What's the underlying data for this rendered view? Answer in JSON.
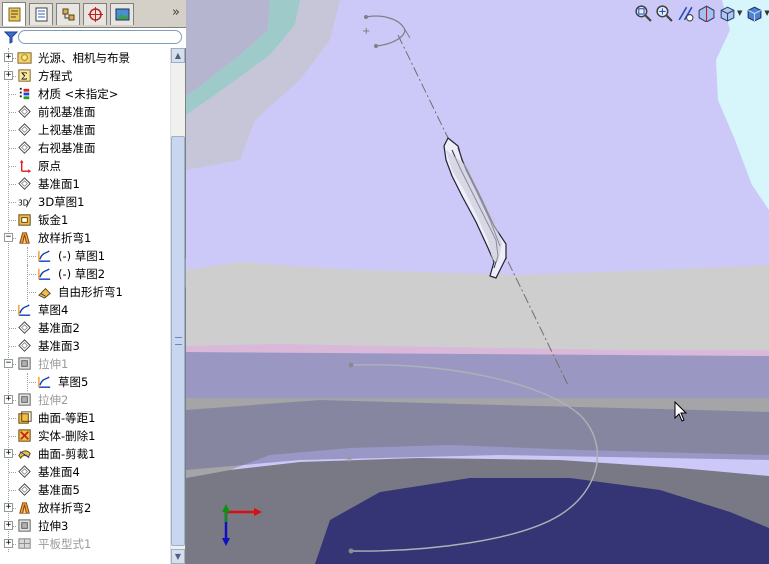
{
  "left_panel": {
    "tabs": [
      {
        "name": "feature-manager-tab",
        "icon": "feature-tree-icon",
        "active": true
      },
      {
        "name": "property-manager-tab",
        "icon": "property-manager-icon",
        "active": false
      },
      {
        "name": "configuration-manager-tab",
        "icon": "configuration-manager-icon",
        "active": false
      },
      {
        "name": "dimxpert-manager-tab",
        "icon": "dimxpert-icon",
        "active": false
      },
      {
        "name": "display-manager-tab",
        "icon": "display-manager-icon",
        "active": false
      }
    ],
    "collapse_glyph": "»",
    "filter": {
      "icon": "filter-icon",
      "value": ""
    }
  },
  "tree": {
    "items": [
      {
        "label": "光源、相机与布景",
        "icon": "lights-cameras-icon",
        "expandable": true,
        "indent": 0,
        "suppressed": false
      },
      {
        "label": "方程式",
        "icon": "equations-icon",
        "expandable": true,
        "indent": 0,
        "suppressed": false
      },
      {
        "label": "材质 <未指定>",
        "icon": "material-icon",
        "expandable": false,
        "indent": 0,
        "suppressed": false
      },
      {
        "label": "前视基准面",
        "icon": "plane-icon",
        "expandable": false,
        "indent": 0,
        "suppressed": false
      },
      {
        "label": "上视基准面",
        "icon": "plane-icon",
        "expandable": false,
        "indent": 0,
        "suppressed": false
      },
      {
        "label": "右视基准面",
        "icon": "plane-icon",
        "expandable": false,
        "indent": 0,
        "suppressed": false
      },
      {
        "label": "原点",
        "icon": "origin-icon",
        "expandable": false,
        "indent": 0,
        "suppressed": false
      },
      {
        "label": "基准面1",
        "icon": "plane-icon",
        "expandable": false,
        "indent": 0,
        "suppressed": false
      },
      {
        "label": "3D草图1",
        "icon": "3d-sketch-icon",
        "expandable": false,
        "indent": 0,
        "suppressed": false
      },
      {
        "label": "钣金1",
        "icon": "sheet-metal-icon",
        "expandable": false,
        "indent": 0,
        "suppressed": false
      },
      {
        "label": "放样折弯1",
        "icon": "lofted-bend-icon",
        "expandable": true,
        "expanded": true,
        "indent": 0,
        "suppressed": false
      },
      {
        "label": "(-) 草图1",
        "icon": "sketch-icon",
        "expandable": false,
        "indent": 1,
        "suppressed": false
      },
      {
        "label": "(-) 草图2",
        "icon": "sketch-icon",
        "expandable": false,
        "indent": 1,
        "suppressed": false
      },
      {
        "label": "自由形折弯1",
        "icon": "freeform-bend-icon",
        "expandable": false,
        "indent": 1,
        "suppressed": false
      },
      {
        "label": "草图4",
        "icon": "sketch-icon",
        "expandable": false,
        "indent": 0,
        "suppressed": false
      },
      {
        "label": "基准面2",
        "icon": "plane-icon",
        "expandable": false,
        "indent": 0,
        "suppressed": false
      },
      {
        "label": "基准面3",
        "icon": "plane-icon",
        "expandable": false,
        "indent": 0,
        "suppressed": false
      },
      {
        "label": "拉伸1",
        "icon": "extrude-icon",
        "expandable": true,
        "expanded": true,
        "indent": 0,
        "suppressed": true
      },
      {
        "label": "草图5",
        "icon": "sketch-icon",
        "expandable": false,
        "indent": 1,
        "suppressed": false
      },
      {
        "label": "拉伸2",
        "icon": "extrude-icon",
        "expandable": true,
        "indent": 0,
        "suppressed": true
      },
      {
        "label": "曲面-等距1",
        "icon": "offset-surface-icon",
        "expandable": false,
        "indent": 0,
        "suppressed": false
      },
      {
        "label": "实体-删除1",
        "icon": "delete-body-icon",
        "expandable": false,
        "indent": 0,
        "suppressed": false
      },
      {
        "label": "曲面-剪裁1",
        "icon": "trim-surface-icon",
        "expandable": true,
        "indent": 0,
        "suppressed": false
      },
      {
        "label": "基准面4",
        "icon": "plane-icon",
        "expandable": false,
        "indent": 0,
        "suppressed": false
      },
      {
        "label": "基准面5",
        "icon": "plane-icon",
        "expandable": false,
        "indent": 0,
        "suppressed": false
      },
      {
        "label": "放样折弯2",
        "icon": "lofted-bend-icon",
        "expandable": true,
        "indent": 0,
        "suppressed": false
      },
      {
        "label": "拉伸3",
        "icon": "extrude-icon",
        "expandable": true,
        "indent": 0,
        "suppressed": false
      },
      {
        "label": "平板型式1",
        "icon": "flat-pattern-icon",
        "expandable": true,
        "indent": 0,
        "suppressed": true
      }
    ]
  },
  "view_toolbar": [
    {
      "name": "zoom-to-fit-button",
      "icon": "zoom-to-fit-icon",
      "dropdown": false
    },
    {
      "name": "zoom-to-area-button",
      "icon": "zoom-to-area-icon",
      "dropdown": false
    },
    {
      "name": "previous-view-button",
      "icon": "previous-view-icon",
      "dropdown": false
    },
    {
      "name": "section-view-button",
      "icon": "section-view-icon",
      "dropdown": false
    },
    {
      "name": "view-orientation-button",
      "icon": "view-orientation-icon",
      "dropdown": true
    },
    {
      "name": "display-style-button",
      "icon": "display-style-icon",
      "dropdown": true
    },
    {
      "name": "hide-show-items-button",
      "icon": "hide-show-icon",
      "dropdown": true
    },
    {
      "name": "edit-appearance-button",
      "icon": "appearance-icon",
      "dropdown": false
    },
    {
      "name": "apply-scene-button",
      "icon": "scene-icon",
      "dropdown": true
    },
    {
      "name": "view-settings-button",
      "icon": "view-settings-icon",
      "dropdown": true
    }
  ],
  "colors": {
    "viewport_bg": "#ccc9f9",
    "tree_text": "#000000",
    "suppressed_text": "#9a9a9a",
    "triad_x": "#d81010",
    "triad_y": "#109010",
    "triad_z": "#1010c0"
  }
}
